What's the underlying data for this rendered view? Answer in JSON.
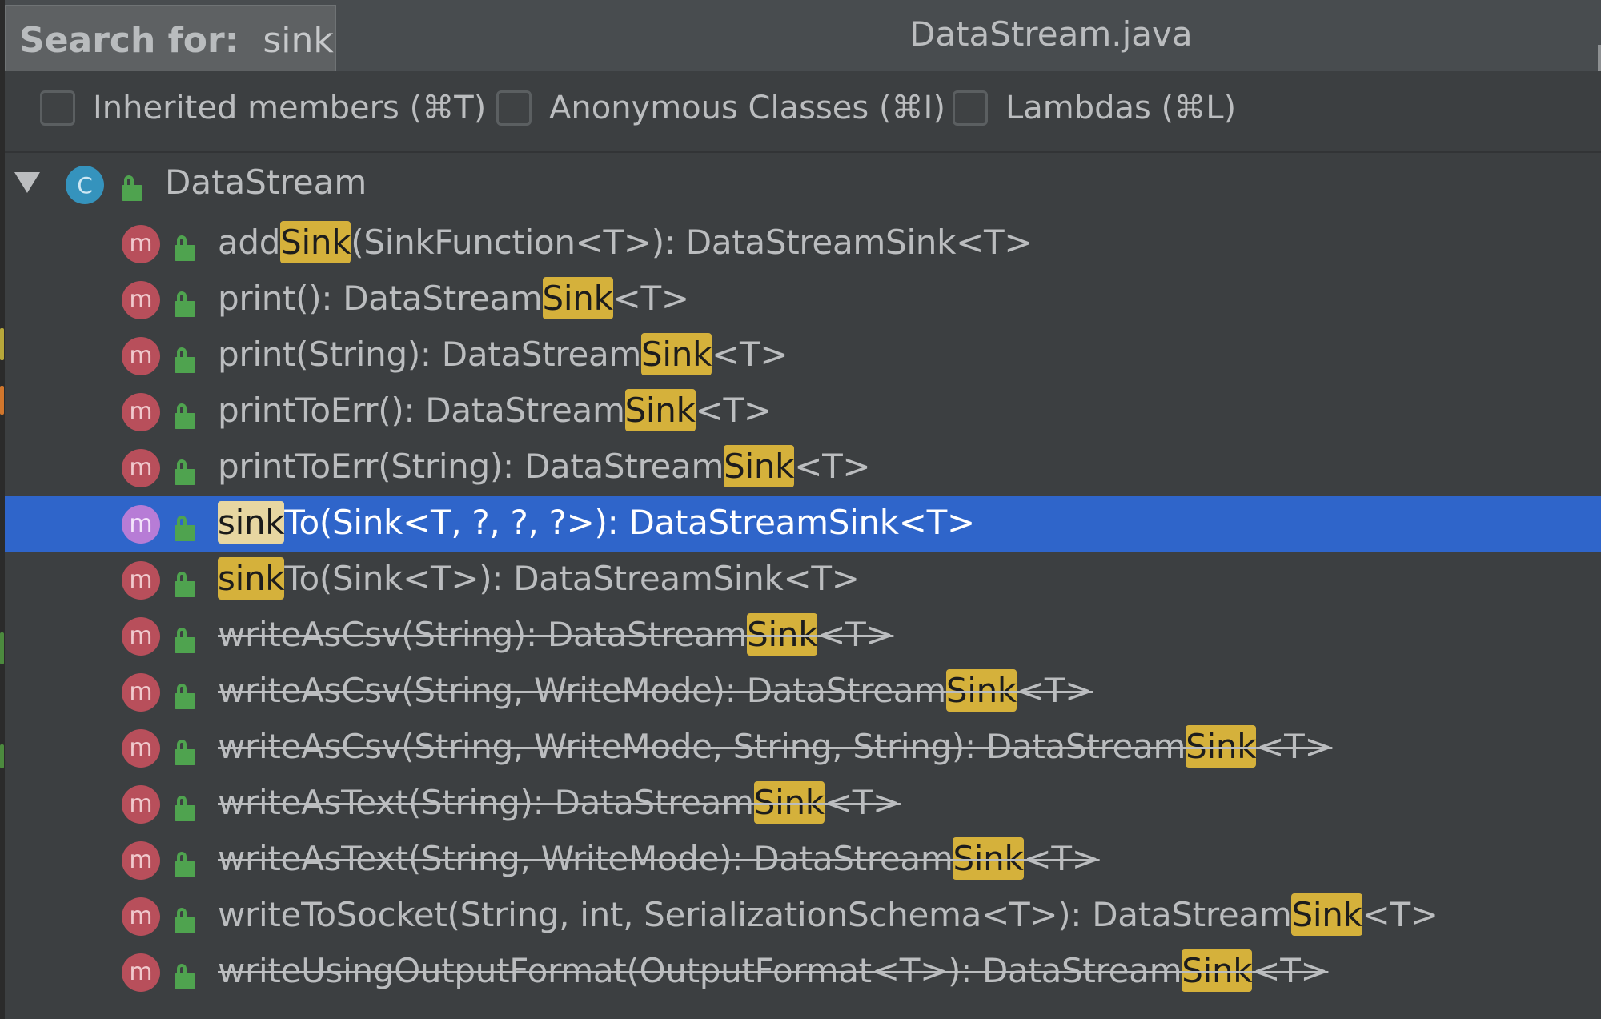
{
  "search": {
    "label": "Search for:",
    "value": "sink"
  },
  "file_title": "DataStream.java",
  "filters": [
    {
      "label": "Inherited members (⌘T)",
      "checked": false
    },
    {
      "label": "Anonymous Classes (⌘I)",
      "checked": false
    },
    {
      "label": "Lambdas (⌘L)",
      "checked": false
    }
  ],
  "tree": {
    "root": {
      "label": "DataStream",
      "icon": "class-icon",
      "icon_letter": "C",
      "expanded": true
    },
    "methods": [
      {
        "pre": "add",
        "match": "Sink",
        "post": "(SinkFunction<T>): DataStreamSink<T>",
        "deprecated": false,
        "selected": false
      },
      {
        "pre": "print(): DataStream",
        "match": "Sink",
        "post": "<T>",
        "deprecated": false,
        "selected": false
      },
      {
        "pre": "print(String): DataStream",
        "match": "Sink",
        "post": "<T>",
        "deprecated": false,
        "selected": false
      },
      {
        "pre": "printToErr(): DataStream",
        "match": "Sink",
        "post": "<T>",
        "deprecated": false,
        "selected": false
      },
      {
        "pre": "printToErr(String): DataStream",
        "match": "Sink",
        "post": "<T>",
        "deprecated": false,
        "selected": false
      },
      {
        "pre": "",
        "match": "sink",
        "post": "To(Sink<T, ?, ?, ?>): DataStreamSink<T>",
        "deprecated": false,
        "selected": true
      },
      {
        "pre": "",
        "match": "sink",
        "post": "To(Sink<T>): DataStreamSink<T>",
        "deprecated": false,
        "selected": false
      },
      {
        "pre": "writeAsCsv(String): DataStream",
        "match": "Sink",
        "post": "<T>",
        "deprecated": true,
        "selected": false
      },
      {
        "pre": "writeAsCsv(String, WriteMode): DataStream",
        "match": "Sink",
        "post": "<T>",
        "deprecated": true,
        "selected": false
      },
      {
        "pre": "writeAsCsv(String, WriteMode, String, String): DataStream",
        "match": "Sink",
        "post": "<T>",
        "deprecated": true,
        "selected": false
      },
      {
        "pre": "writeAsText(String): DataStream",
        "match": "Sink",
        "post": "<T>",
        "deprecated": true,
        "selected": false
      },
      {
        "pre": "writeAsText(String, WriteMode): DataStream",
        "match": "Sink",
        "post": "<T>",
        "deprecated": true,
        "selected": false
      },
      {
        "pre": "writeToSocket(String, int, SerializationSchema<T>): DataStream",
        "match": "Sink",
        "post": "<T>",
        "deprecated": false,
        "selected": false
      },
      {
        "pre": "writeUsingOutputFormat(OutputFormat<T>): DataStream",
        "match": "Sink",
        "post": "<T>",
        "deprecated": true,
        "selected": false
      }
    ],
    "method_icon_letter": "m"
  },
  "colors": {
    "background": "#3c3f41",
    "selection": "#2f65ca",
    "match_highlight": "#d5b13b",
    "method_icon": "#b84f5b",
    "class_icon": "#3593bd",
    "public_lock": "#4fa34f"
  }
}
